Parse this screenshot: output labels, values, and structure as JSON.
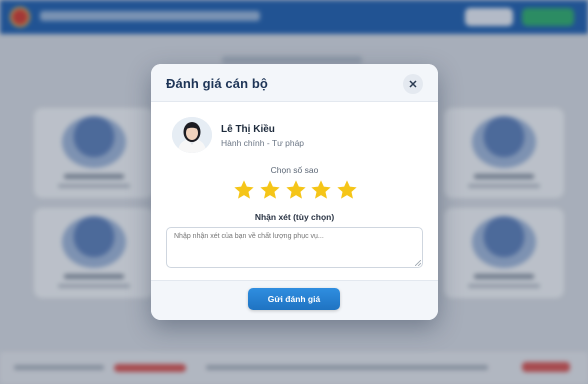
{
  "modal": {
    "title": "Đánh giá cán bộ",
    "close_icon": "close-icon",
    "staff": {
      "name": "Lê Thị Kiều",
      "department": "Hành chính - Tư pháp",
      "avatar_icon": "avatar-photo"
    },
    "rating": {
      "label": "Chọn số sao",
      "max_stars": 5,
      "selected_stars": 5,
      "star_color": "#f5c518"
    },
    "comment": {
      "label": "Nhận xét (tùy chọn)",
      "value": "",
      "placeholder": "Nhập nhận xét của bạn về chất lượng phục vụ..."
    },
    "submit_label": "Gửi đánh giá"
  },
  "colors": {
    "header_bar": "#1f5fae",
    "primary_button": "#1f73c2",
    "title_text": "#1e3557"
  }
}
